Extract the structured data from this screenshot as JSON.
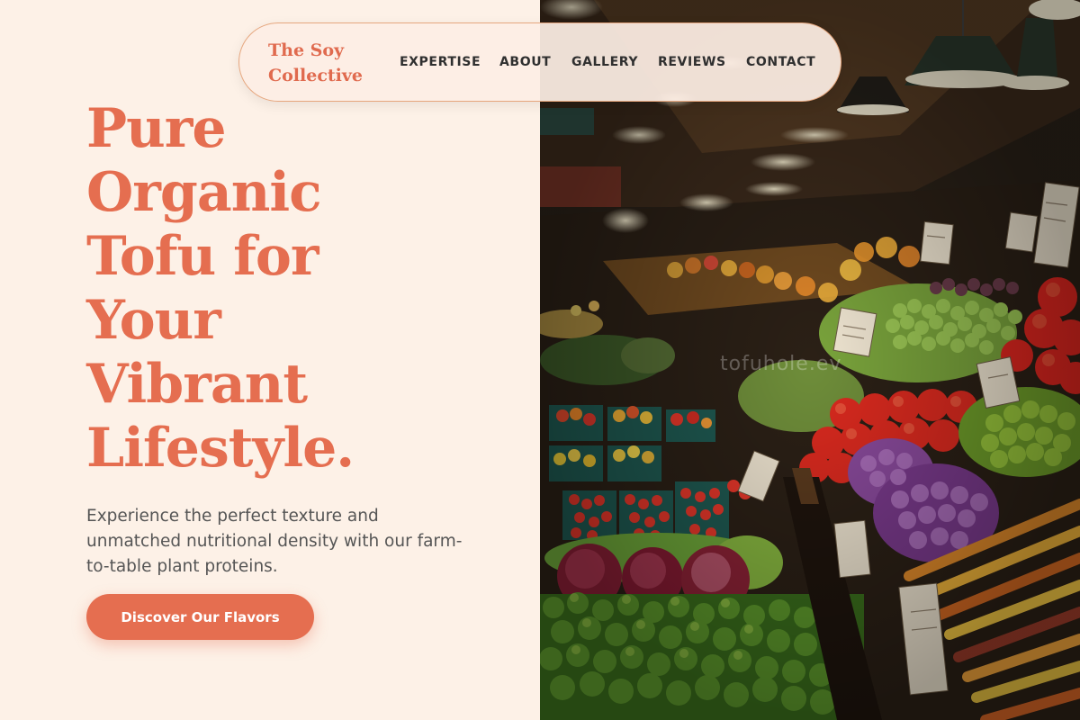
{
  "brand": {
    "name": "The Soy Collective"
  },
  "nav": {
    "links": [
      "EXPERTISE",
      "ABOUT",
      "GALLERY",
      "REVIEWS",
      "CONTACT"
    ]
  },
  "hero": {
    "title_lines": [
      "Pure",
      "Organic",
      "Tofu for",
      "Your",
      "Vibrant",
      "Lifestyle."
    ],
    "subtitle": "Experience the perfect texture and unmatched nutritional density with our farm-to-table plant proteins.",
    "cta_label": "Discover Our Flavors"
  },
  "image": {
    "subject": "farmers-market-produce-stall",
    "watermark": "tofuhole.ev"
  },
  "colors": {
    "background": "#fdf1e7",
    "accent": "#e56e50",
    "nav_border": "#e6a77f",
    "text_dark": "#2f2f2f",
    "text_body": "#555555"
  }
}
